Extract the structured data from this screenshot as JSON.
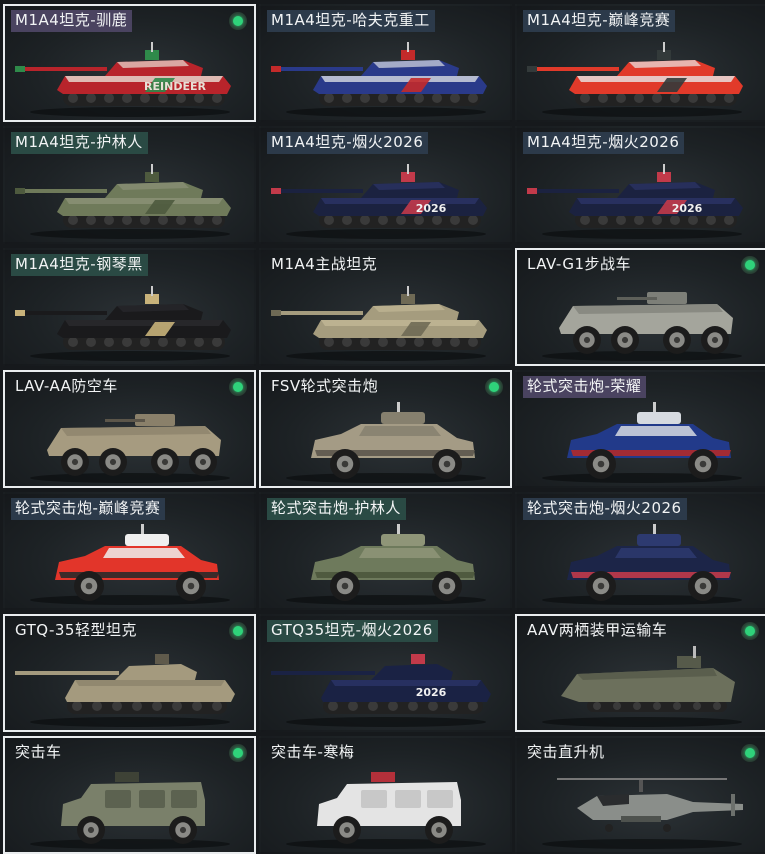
{
  "cards": [
    {
      "name": "M1A4坦克-驯鹿",
      "badge": "purple",
      "selected": true,
      "owned": true,
      "kind": "tank",
      "paint": "reindeer",
      "colors": [
        "#b8242b",
        "#e8e0d6",
        "#2f8a4a"
      ],
      "decal": "REINDEER"
    },
    {
      "name": "M1A4坦克-哈夫克重工",
      "badge": "dark",
      "selected": false,
      "owned": false,
      "kind": "tank",
      "paint": "haavk",
      "colors": [
        "#2a3a8a",
        "#d8dce2",
        "#c32a2a"
      ],
      "decal": ""
    },
    {
      "name": "M1A4坦克-巅峰竞赛",
      "badge": "dark",
      "selected": false,
      "owned": false,
      "kind": "tank",
      "paint": "race",
      "colors": [
        "#e13a2a",
        "#e9e9e9",
        "#333a3a"
      ],
      "decal": ""
    },
    {
      "name": "M1A4坦克-护林人",
      "badge": "teal",
      "selected": false,
      "owned": false,
      "kind": "tank",
      "paint": "forest",
      "colors": [
        "#6f7a5a",
        "#8c9277",
        "#4e5a3e"
      ],
      "decal": ""
    },
    {
      "name": "M1A4坦克-烟火2026",
      "badge": "dark",
      "selected": false,
      "owned": false,
      "kind": "tank",
      "paint": "fireworks",
      "colors": [
        "#1b2240",
        "#2c3566",
        "#c23a4a"
      ],
      "decal": "2026"
    },
    {
      "name": "M1A4坦克-烟火2026",
      "badge": "dark",
      "selected": false,
      "owned": false,
      "kind": "tank",
      "paint": "fireworks",
      "colors": [
        "#1b2240",
        "#2c3566",
        "#c23a4a"
      ],
      "decal": "2026"
    },
    {
      "name": "M1A4坦克-钢琴黑",
      "badge": "teal",
      "selected": false,
      "owned": false,
      "kind": "tank",
      "paint": "black",
      "colors": [
        "#1a1a1c",
        "#2a2a2e",
        "#c8b27a"
      ],
      "decal": ""
    },
    {
      "name": "M1A4主战坦克",
      "badge": "none",
      "selected": false,
      "owned": false,
      "kind": "tank",
      "paint": "desert",
      "colors": [
        "#a59c7e",
        "#c2b896",
        "#6f6a55"
      ],
      "decal": ""
    },
    {
      "name": "LAV-G1步战车",
      "badge": "none",
      "selected": true,
      "owned": true,
      "kind": "apc8",
      "paint": "grey",
      "colors": [
        "#a4a59c",
        "#7d7f78",
        "#5e605a"
      ],
      "decal": ""
    },
    {
      "name": "LAV-AA防空车",
      "badge": "none",
      "selected": true,
      "owned": true,
      "kind": "apc8",
      "paint": "tan",
      "colors": [
        "#a69b80",
        "#8a806a",
        "#5c564a"
      ],
      "decal": ""
    },
    {
      "name": "FSV轮式突击炮",
      "badge": "none",
      "selected": true,
      "owned": true,
      "kind": "armoredcar",
      "paint": "tan",
      "colors": [
        "#a49b85",
        "#86806e",
        "#5c574c"
      ],
      "decal": ""
    },
    {
      "name": "轮式突击炮-荣耀",
      "badge": "purple",
      "selected": false,
      "owned": false,
      "kind": "armoredcar",
      "paint": "glory",
      "colors": [
        "#223a8a",
        "#d6dae0",
        "#b02a2a"
      ],
      "decal": ""
    },
    {
      "name": "轮式突击炮-巅峰竞赛",
      "badge": "dark",
      "selected": false,
      "owned": false,
      "kind": "armoredcar",
      "paint": "race",
      "colors": [
        "#e2352a",
        "#efefef",
        "#2a2a2a"
      ],
      "decal": ""
    },
    {
      "name": "轮式突击炮-护林人",
      "badge": "teal",
      "selected": false,
      "owned": false,
      "kind": "armoredcar",
      "paint": "forest",
      "colors": [
        "#6e7a5c",
        "#8f9578",
        "#4b563c"
      ],
      "decal": ""
    },
    {
      "name": "轮式突击炮-烟火2026",
      "badge": "dark",
      "selected": false,
      "owned": false,
      "kind": "armoredcar",
      "paint": "fireworks",
      "colors": [
        "#1c2548",
        "#2d3a70",
        "#c23a4a"
      ],
      "decal": ""
    },
    {
      "name": "GTQ-35轻型坦克",
      "badge": "none",
      "selected": true,
      "owned": true,
      "kind": "lighttank",
      "paint": "tan",
      "colors": [
        "#a49a7e",
        "#8c836b",
        "#5f5a4b"
      ],
      "decal": ""
    },
    {
      "name": "GTQ35坦克-烟火2026",
      "badge": "teal",
      "selected": false,
      "owned": false,
      "kind": "lighttank",
      "paint": "fireworks",
      "colors": [
        "#1a2244",
        "#2a3568",
        "#c23a4a"
      ],
      "decal": "2026"
    },
    {
      "name": "AAV两栖装甲运输车",
      "badge": "none",
      "selected": true,
      "owned": true,
      "kind": "aav",
      "paint": "olive",
      "colors": [
        "#6c705c",
        "#565a4a",
        "#3e4136"
      ],
      "decal": ""
    },
    {
      "name": "突击车",
      "badge": "none",
      "selected": true,
      "owned": true,
      "kind": "mrap",
      "paint": "olive",
      "colors": [
        "#7a806a",
        "#5c6250",
        "#3e4236"
      ],
      "decal": ""
    },
    {
      "name": "突击车-寒梅",
      "badge": "none",
      "selected": false,
      "owned": false,
      "kind": "mrap",
      "paint": "plum",
      "colors": [
        "#e4e4e4",
        "#c8c8c8",
        "#b3303a"
      ],
      "decal": ""
    },
    {
      "name": "突击直升机",
      "badge": "none",
      "selected": false,
      "owned": true,
      "kind": "heli",
      "paint": "grey",
      "colors": [
        "#8a8e8a",
        "#6c706c",
        "#4e524e"
      ],
      "decal": ""
    }
  ]
}
